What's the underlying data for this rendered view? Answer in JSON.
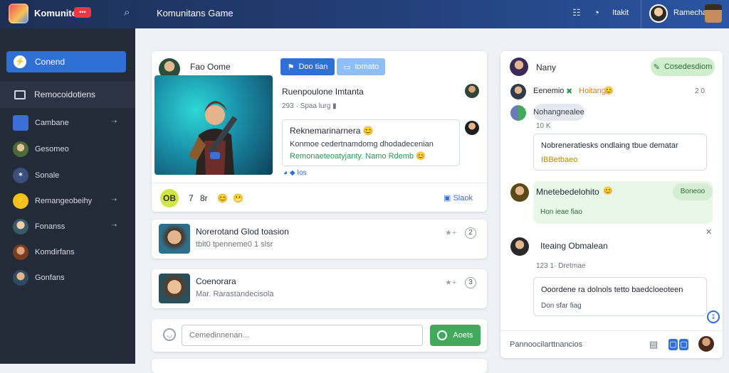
{
  "topbar": {
    "brand": "Komunite",
    "badge": "•••",
    "title": "Komunitans Game",
    "menu_icon": "list-icon",
    "link": "Itakit",
    "user": "Ramechaeo"
  },
  "sidebar": {
    "primary": "Conend",
    "section": "Remocoidotiens",
    "items": [
      {
        "label": "Cambane",
        "avatar_color": "#3b6fd6"
      },
      {
        "label": "Gesomeo",
        "avatar_color": "#6b8f47"
      },
      {
        "label": "Sonale",
        "avatar_color": "#3b4f7c"
      },
      {
        "label": "Remangeobeihy",
        "avatar_color": "#f2c21c"
      },
      {
        "label": "Fonanss",
        "avatar_color": "#c7a27c"
      },
      {
        "label": "Komdirfans",
        "avatar_color": "#b0583a"
      },
      {
        "label": "Gonfans",
        "avatar_color": "#4b6b86"
      }
    ]
  },
  "post": {
    "author": "Fao Oome",
    "btn_primary": "Doo tian",
    "btn_secondary": "tomato",
    "headline": "Ruenpoulone Imtanta",
    "meta": "293 · Spaa lurg ▮",
    "inner_title": "Reknemarinarnera 😊",
    "inner_line1": "Konmoe cedertnamdomg dhodadecenian",
    "inner_line2": "Remonaeteoatyjanty. Namo Rdemb 😊",
    "foot_link": "Ios",
    "react_main": "OB",
    "react_count": "7",
    "react_extra": "8r",
    "share": "Slaok"
  },
  "rows": [
    {
      "title": "Norerotand Glod toasion",
      "sub": "tbit0 tpenneme0 1 slsr",
      "count": "2"
    },
    {
      "title": "Coenorara",
      "sub": "Mar. Rarastandecisola",
      "count": "3"
    }
  ],
  "compose": {
    "placeholder": "Cemedinnenan...",
    "button": "Aoets"
  },
  "chat": {
    "header_name": "Nany",
    "header_pill": "Cosedesdiom",
    "msg1_name": "Eenemio",
    "msg1_extra": "Hoitang",
    "msg1_time": "2 0",
    "msg1_bubble": "Nohangnealee",
    "msg1_sub": "10 K",
    "box1_line1": "Nobreneratiesks ondlaing tbue dematar",
    "box1_line2": "IBBetbaeo",
    "msg2_name": "Mnetebedelohito",
    "msg2_tag": "Boneoo",
    "msg2_sub": "Hon ieae fiao",
    "msg3_name": "Iteaing Obmalean",
    "msg3_time": "123 1· Dretmae",
    "box2_line1": "Ooordene ra dolnols tetto baedcloeoteen",
    "box2_line2": "Don sfar fiag",
    "footer": "Pannoocilarttnancios"
  }
}
